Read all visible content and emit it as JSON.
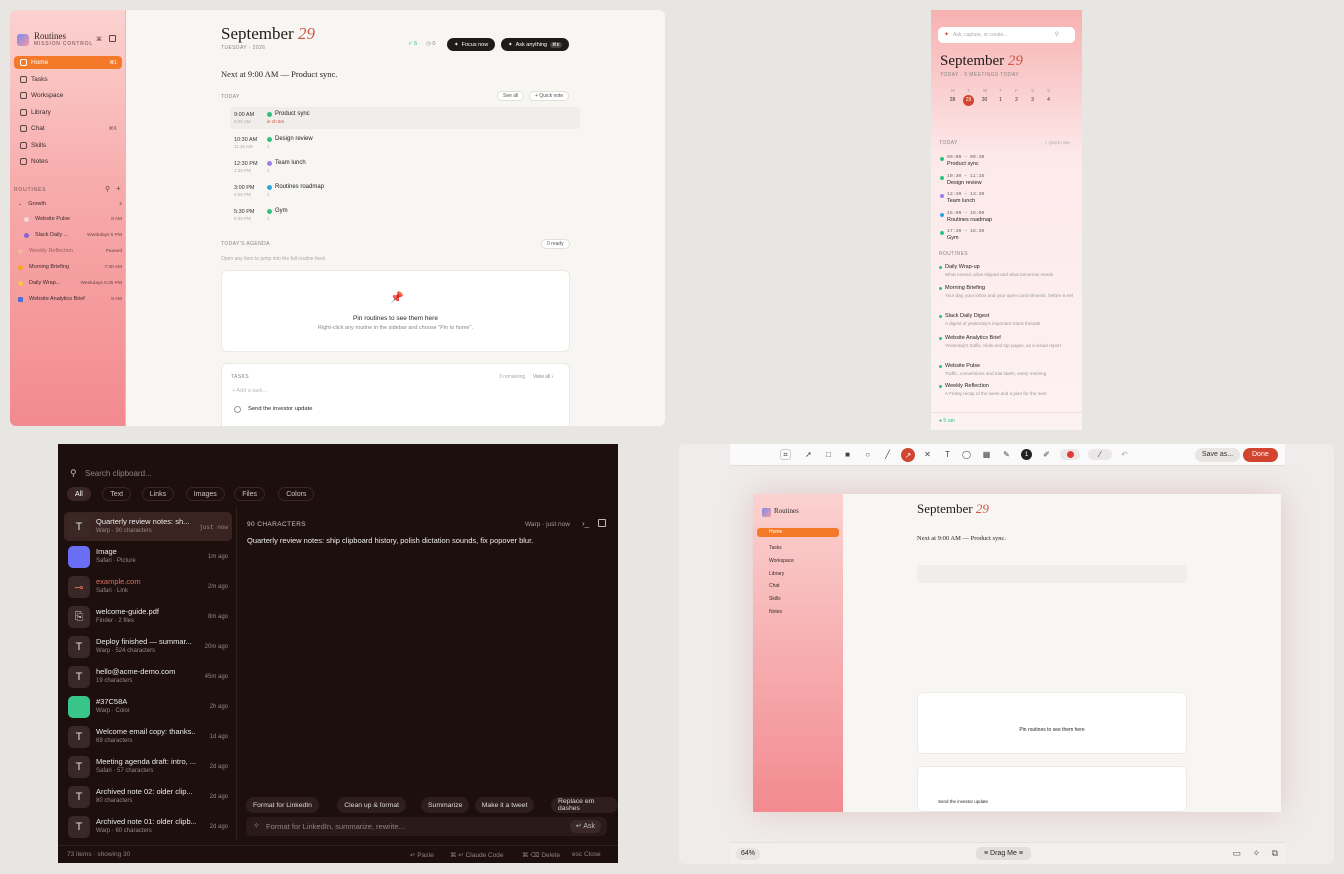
{
  "panel1": {
    "app_title": "Routines",
    "app_sub": "MISSION CONTROL",
    "nav": [
      {
        "label": "Home",
        "kbd": "⌘1"
      },
      {
        "label": "Tasks",
        "kbd": ""
      },
      {
        "label": "Workspace",
        "kbd": ""
      },
      {
        "label": "Library",
        "kbd": ""
      },
      {
        "label": "Chat",
        "kbd": "⌘K"
      },
      {
        "label": "Skills",
        "kbd": ""
      },
      {
        "label": "Notes",
        "kbd": ""
      }
    ],
    "routines_header": "ROUTINES",
    "group": {
      "label": "Growth",
      "count": "2"
    },
    "routines": [
      {
        "label": "Website Pulse",
        "right": "8 AM"
      },
      {
        "label": "Slack Daily ...",
        "right": "Weekdays 5 PM"
      },
      {
        "label": "Weekly Reflection",
        "right": "Paused"
      },
      {
        "label": "Morning Briefing",
        "right": "7:30 AM"
      },
      {
        "label": "Daily Wrap...",
        "right": "Weekdays 5:45 PM"
      },
      {
        "label": "Website Analytics Brief",
        "right": "9 AM"
      }
    ],
    "date_month": "September",
    "date_day": "29",
    "date_sub": "TUESDAY · 2026",
    "stat1": "5",
    "stat2": "0",
    "focus": "Focus now",
    "ask": "Ask anything",
    "ask_kbd": "⌘E",
    "next": "Next at 9:00 AM — Product sync.",
    "today": "TODAY",
    "see_all": "See all",
    "quick_note": "+ Quick note",
    "events": [
      {
        "t1": "9:00 AM",
        "t2": "9:30 AM",
        "name": "Product sync",
        "sub": "in 1h 6m",
        "color": "#2ec27e"
      },
      {
        "t1": "10:30 AM",
        "t2": "11:15 AM",
        "name": "Design review",
        "sub": "1",
        "color": "#2ec27e"
      },
      {
        "t1": "12:30 PM",
        "t2": "1:30 PM",
        "name": "Team lunch",
        "sub": "1",
        "color": "#9b7ee8"
      },
      {
        "t1": "3:00 PM",
        "t2": "4:00 PM",
        "name": "Routines roadmap",
        "sub": "1",
        "color": "#2ea8d8"
      },
      {
        "t1": "5:30 PM",
        "t2": "6:30 PM",
        "name": "Gym",
        "sub": "1",
        "color": "#2ec27e"
      }
    ],
    "agenda": "TODAY'S AGENDA",
    "agenda_ready": "0 ready",
    "agenda_hint": "Open any item to jump into the full routine feed.",
    "pin_title": "Pin routines to see them here",
    "pin_hint": "Right-click any routine in the sidebar and choose \"Pin to home\".",
    "tasks": "TASKS",
    "remaining": "3 remaining",
    "view_all": "View all ›",
    "add_task": "+ Add a task...",
    "task1": "Send the investor update"
  },
  "panel2": {
    "search": "Ask, capture, or create...",
    "month": "September",
    "day": "29",
    "sub": "TODAY · 5 MEETINGS TODAY",
    "wk": [
      "M",
      "T",
      "W",
      "T",
      "F",
      "S",
      "S"
    ],
    "nums": [
      "28",
      "29",
      "30",
      "1",
      "2",
      "3",
      "4"
    ],
    "today": "TODAY",
    "quick": "+ Quick note",
    "events": [
      {
        "time": "09:00 – 09:30",
        "name": "Product sync"
      },
      {
        "time": "10:30 – 11:15",
        "name": "Design review"
      },
      {
        "time": "12:30 – 13:30",
        "name": "Team lunch"
      },
      {
        "time": "15:00 – 16:00",
        "name": "Routines roadmap"
      },
      {
        "time": "17:30 – 18:30",
        "name": "Gym"
      }
    ],
    "routines": "ROUTINES",
    "items": [
      {
        "name": "Daily Wrap-up",
        "desc": "What moved, what slipped and what tomorrow needs"
      },
      {
        "name": "Morning Briefing",
        "desc": "Your day, your inbox and your open commitments, before 8 AM"
      },
      {
        "name": "Slack Daily Digest",
        "desc": "A digest of yesterday's important Slack threads"
      },
      {
        "name": "Website Analytics Brief",
        "desc": "Yesterday's traffic, trials and top pages, as a visual report"
      },
      {
        "name": "Website Pulse",
        "desc": "Traffic, conversions and trial starts, every morning"
      },
      {
        "name": "Weekly Reflection",
        "desc": "A Friday recap of the week and a plan for the next"
      }
    ],
    "footer": "5 ran"
  },
  "panel3": {
    "search": "Search clipboard...",
    "filters": [
      "All",
      "Text",
      "Links",
      "Images",
      "Files",
      "Colors"
    ],
    "items": [
      {
        "icon": "T",
        "title": "Quarterly review notes: sh...",
        "sub": "Warp · 90 characters",
        "time": "just now"
      },
      {
        "icon": "img",
        "title": "Image",
        "sub": "Safari · Picture",
        "time": "1m ago"
      },
      {
        "icon": "link",
        "title": "example.com",
        "sub": "Safari · Link",
        "time": "2m ago"
      },
      {
        "icon": "file",
        "title": "welcome-guide.pdf",
        "sub": "Finder · 2 files",
        "time": "8m ago"
      },
      {
        "icon": "T",
        "title": "Deploy finished — summar...",
        "sub": "Warp · 524 characters",
        "time": "20m ago"
      },
      {
        "icon": "T",
        "title": "hello@acme-demo.com",
        "sub": "19 characters",
        "time": "45m ago"
      },
      {
        "icon": "color",
        "title": "#37C58A",
        "sub": "Warp · Color",
        "time": "2h ago"
      },
      {
        "icon": "T",
        "title": "Welcome email copy: thanks...",
        "sub": "69 characters",
        "time": "1d ago"
      },
      {
        "icon": "T",
        "title": "Meeting agenda draft: intro, ...",
        "sub": "Safari · 57 characters",
        "time": "2d ago"
      },
      {
        "icon": "T",
        "title": "Archived note 02: older clip...",
        "sub": "80 characters",
        "time": "2d ago"
      },
      {
        "icon": "T",
        "title": "Archived note 01: older clipb...",
        "sub": "Warp · 60 characters",
        "time": "2d ago"
      }
    ],
    "detail_head": "90 CHARACTERS",
    "detail_src": "Warp · just now",
    "detail_text": "Quarterly review notes: ship clipboard history, polish dictation sounds, fix popover blur.",
    "actions": [
      "Format for LinkedIn",
      "Clean up & format",
      "Summarize",
      "Make it a tweet",
      "Replace em dashes"
    ],
    "prompt": "Format for LinkedIn, summarize, rewrite...",
    "ask": "Ask",
    "status": "73 items · showing 30",
    "hints": [
      "Paste",
      "Claude Code",
      "Delete",
      "Close"
    ],
    "esc": "esc"
  },
  "panel4": {
    "save": "Save as...",
    "done": "Done",
    "zoom": "64%",
    "drag": "Drag Me",
    "accent": "#d2452f"
  }
}
